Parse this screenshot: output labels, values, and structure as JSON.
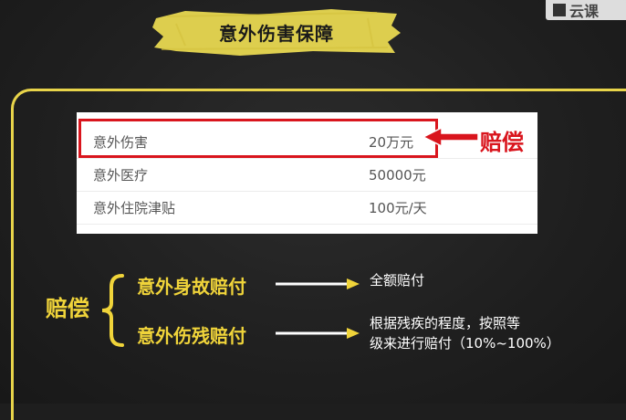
{
  "logo": {
    "text": "云课"
  },
  "title": "意外伤害保障",
  "table": {
    "rows": [
      {
        "name": "意外伤害",
        "value": "20万元"
      },
      {
        "name": "意外医疗",
        "value": "50000元"
      },
      {
        "name": "意外住院津贴",
        "value": "100元/天"
      }
    ]
  },
  "highlight_label": "赔偿",
  "compensation": {
    "label": "赔偿",
    "items": [
      {
        "name": "意外身故赔付",
        "desc": "全额赔付"
      },
      {
        "name": "意外伤残赔付",
        "desc_line1": "根据残疾的程度，按照等",
        "desc_line2": "级来进行赔付（10%~100%）"
      }
    ]
  },
  "colors": {
    "accent_yellow": "#f0d43a",
    "highlight_red": "#d9151d",
    "board": "#1e1e1e"
  }
}
